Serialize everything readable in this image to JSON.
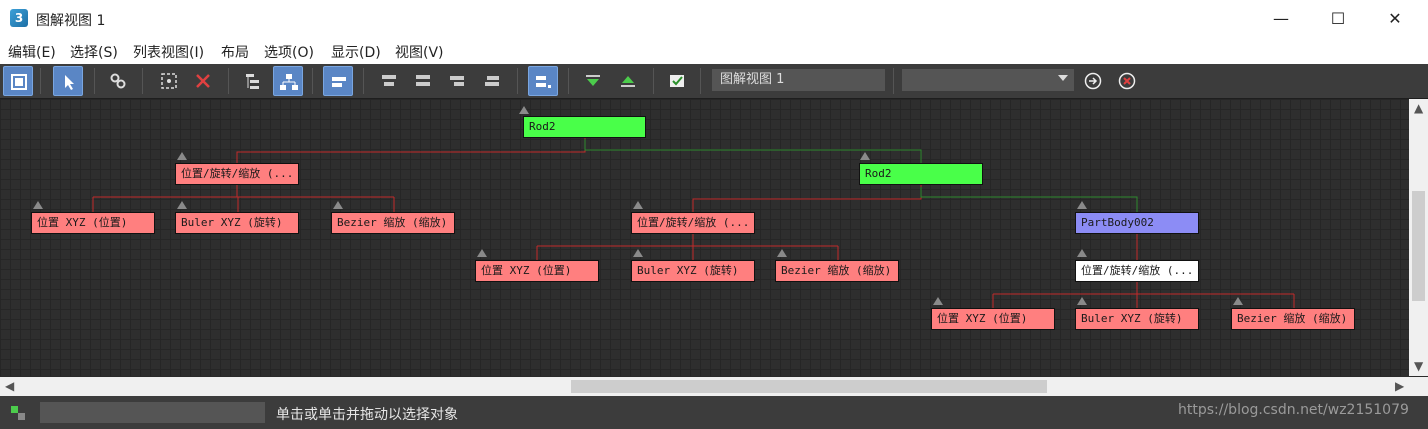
{
  "window": {
    "title": "图解视图 1"
  },
  "menu": [
    "编辑(E)",
    "选择(S)",
    "列表视图(I)",
    "布局",
    "选项(O)",
    "显示(D)",
    "视图(V)"
  ],
  "toolbar": {
    "view_name": "图解视图  1",
    "view_select": "",
    "icons": [
      "display-floater-icon",
      "select-icon",
      "connect-icon",
      "unlink-icon",
      "delete-icon",
      "hierarchy-mode-icon",
      "references-mode-icon",
      "align-left-icon",
      "align-top-icon",
      "align-center-icon",
      "align-bottom-icon",
      "align-right-icon",
      "arrange-icon",
      "expand-icon",
      "collapse-icon",
      "preferences-icon"
    ]
  },
  "nodes": {
    "n1": "Rod2",
    "n2": "位置/旋转/缩放 (...",
    "n3": "位置 XYZ (位置)",
    "n4": "Buler XYZ (旋转)",
    "n5": "Bezier 缩放 (缩放)",
    "n6": "Rod2",
    "n7": "位置/旋转/缩放 (...",
    "n8": "位置 XYZ (位置)",
    "n9": "Buler XYZ (旋转)",
    "n10": "Bezier 缩放 (缩放)",
    "n11": "PartBody002",
    "n12": "位置/旋转/缩放 (...",
    "n13": "位置 XYZ (位置)",
    "n14": "Buler XYZ (旋转)",
    "n15": "Bezier 缩放 (缩放)"
  },
  "status": {
    "prompt": "单击或单击并拖动以选择对象",
    "watermark": "https://blog.csdn.net/wz2151079"
  },
  "colors": {
    "controller_node": "#ff7f7f",
    "object_node": "#49ff49",
    "selected_node": "#8c8cf5",
    "link_red": "#c22a2a",
    "link_green": "#2e8b2e"
  }
}
